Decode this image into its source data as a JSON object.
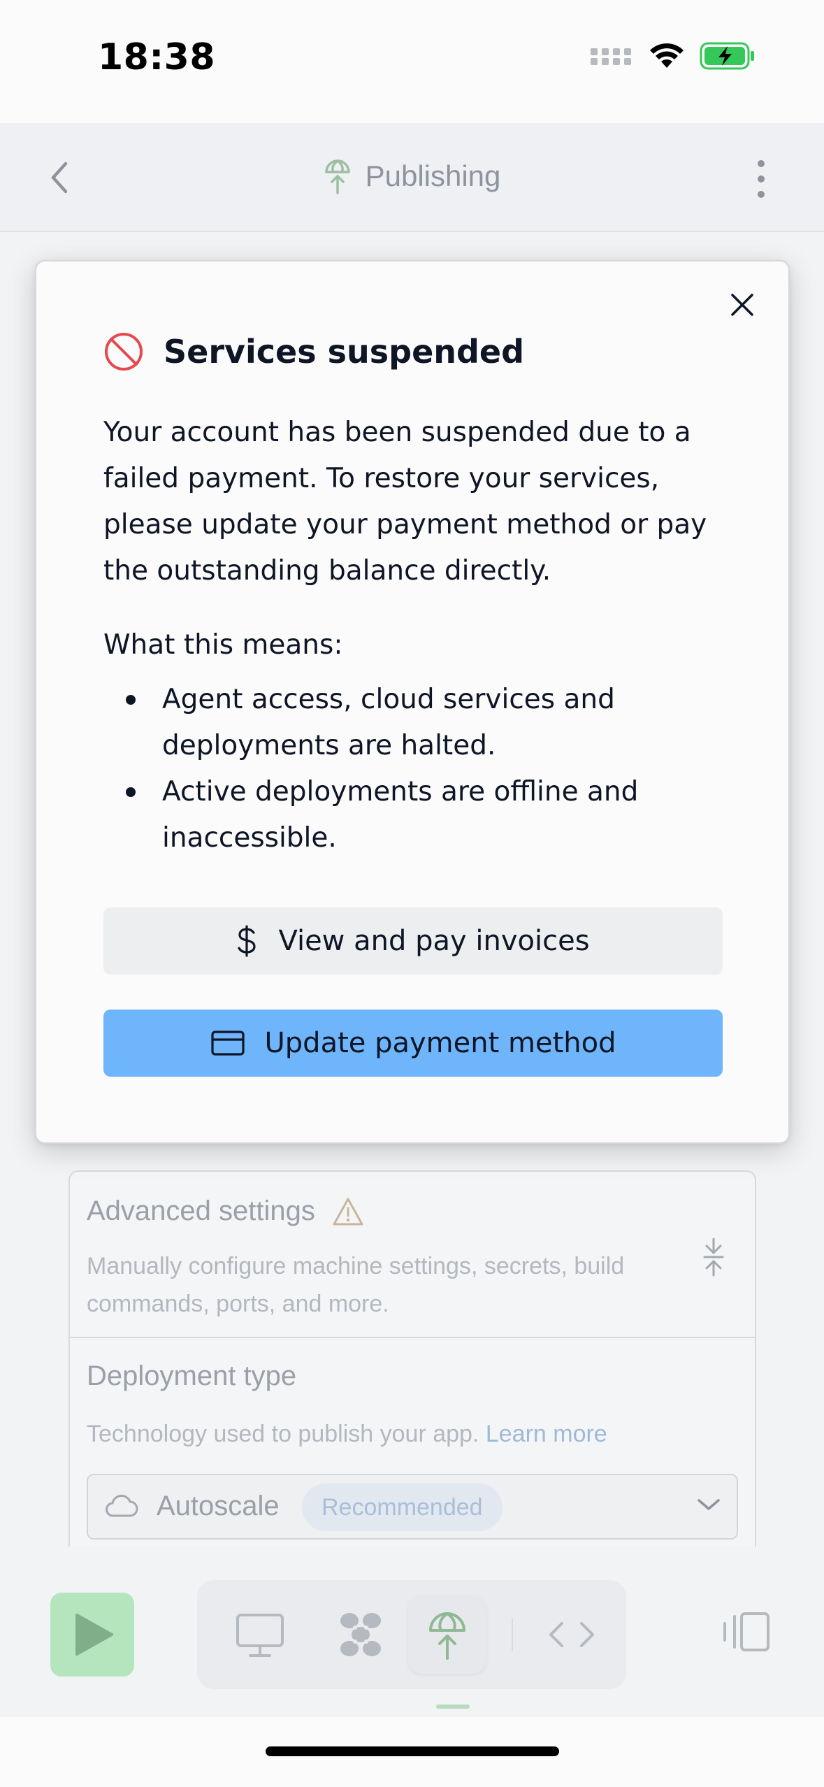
{
  "status_bar": {
    "time": "18:38"
  },
  "header": {
    "title": "Publishing"
  },
  "modal": {
    "title": "Services suspended",
    "body": "Your account has been suspended due to a failed payment. To restore your services, please update your payment method or pay the outstanding balance directly.",
    "means_label": "What this means:",
    "bullets": [
      "Agent access, cloud services and deployments are halted.",
      "Active deployments are offline and inaccessible."
    ],
    "invoices_button": "View and pay invoices",
    "update_button": "Update payment method",
    "icons": {
      "title": "prohibited-icon",
      "invoices": "dollar-icon",
      "update": "credit-card-icon",
      "close": "close-icon"
    },
    "colors": {
      "danger": "#e5484d",
      "primary": "#6eb5fb"
    }
  },
  "advanced_settings": {
    "title": "Advanced settings",
    "description": "Manually configure machine settings, secrets, build commands, ports, and more."
  },
  "deployment_type": {
    "title": "Deployment type",
    "description": "Technology used to publish your app.",
    "learn_more": "Learn more",
    "selected": "Autoscale",
    "badge": "Recommended"
  },
  "toolbar": {
    "items": [
      "run-icon",
      "preview-icon",
      "workspace-icon",
      "publishing-icon",
      "code-icon",
      "panel-icon"
    ],
    "active": "publishing-icon"
  }
}
